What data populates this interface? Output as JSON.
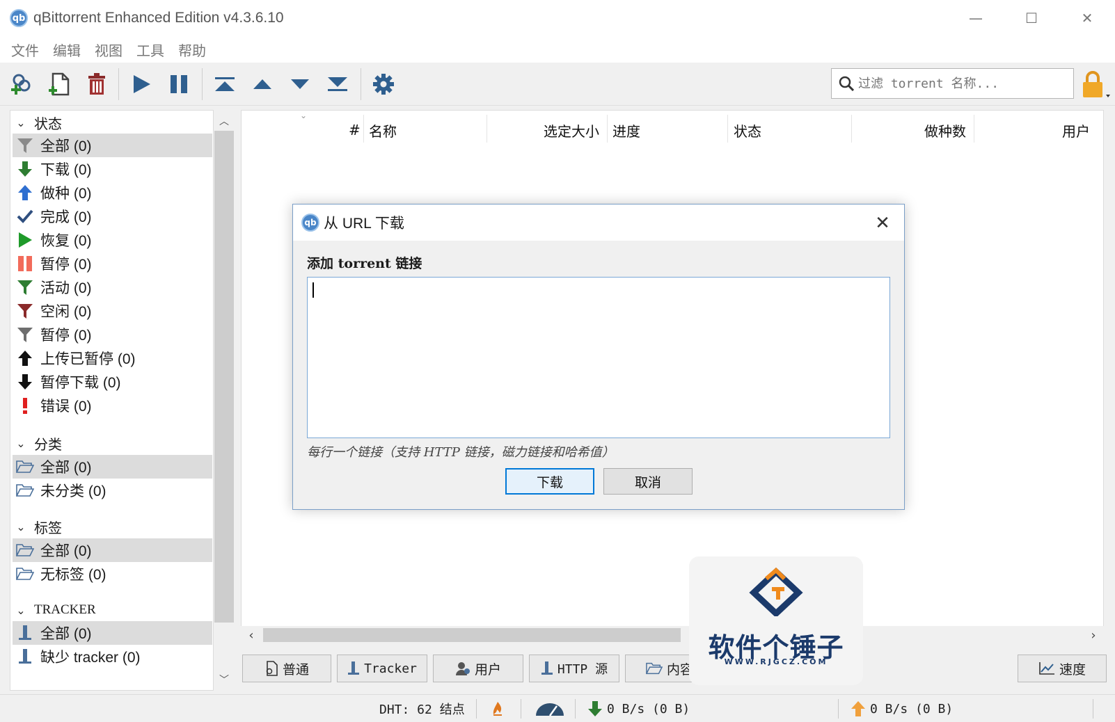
{
  "window": {
    "title": "qBittorrent Enhanced Edition v4.3.6.10",
    "logo_text": "qb",
    "minimize": "—",
    "maximize": "☐",
    "close": "✕"
  },
  "menu": [
    "文件",
    "编辑",
    "视图",
    "工具",
    "帮助"
  ],
  "toolbar": {
    "search_placeholder": "过滤 torrent 名称..."
  },
  "sidebar": {
    "sections": [
      {
        "label": "状态"
      },
      {
        "label": "分类"
      },
      {
        "label": "标签"
      },
      {
        "label": "TRACKER"
      }
    ],
    "status_items": [
      {
        "label": "全部 (0)",
        "icon": "filter-gray-icon"
      },
      {
        "label": "下载 (0)",
        "icon": "download-arrow-icon"
      },
      {
        "label": "做种 (0)",
        "icon": "upload-arrow-icon"
      },
      {
        "label": "完成 (0)",
        "icon": "checkmark-icon"
      },
      {
        "label": "恢复 (0)",
        "icon": "play-icon"
      },
      {
        "label": "暂停 (0)",
        "icon": "pause-icon"
      },
      {
        "label": "活动 (0)",
        "icon": "filter-green-icon"
      },
      {
        "label": "空闲 (0)",
        "icon": "filter-red-icon"
      },
      {
        "label": "暂停 (0)",
        "icon": "filter-gray-icon"
      },
      {
        "label": "上传已暂停 (0)",
        "icon": "upload-paused-icon"
      },
      {
        "label": "暂停下载 (0)",
        "icon": "download-paused-icon"
      },
      {
        "label": "错误 (0)",
        "icon": "error-icon"
      }
    ],
    "category_items": [
      {
        "label": "全部 (0)"
      },
      {
        "label": "未分类 (0)"
      }
    ],
    "tag_items": [
      {
        "label": "全部 (0)"
      },
      {
        "label": "无标签 (0)"
      }
    ],
    "tracker_items": [
      {
        "label": "全部 (0)"
      },
      {
        "label": "缺少 tracker (0)"
      }
    ]
  },
  "columns": [
    "#",
    "名称",
    "选定大小",
    "进度",
    "状态",
    "做种数",
    "用户"
  ],
  "bottom_tabs": [
    {
      "label": "普通",
      "icon": "general-doc-icon"
    },
    {
      "label": "Tracker",
      "icon": "tracker-icon"
    },
    {
      "label": "用户",
      "icon": "peers-icon"
    },
    {
      "label": "HTTP 源",
      "icon": "http-source-icon"
    },
    {
      "label": "内容",
      "icon": "folder-icon"
    },
    {
      "label": "速度",
      "icon": "speed-chart-icon"
    }
  ],
  "statusbar": {
    "dht": "DHT: 62 结点",
    "download": "0 B/s (0 B)",
    "upload": "0 B/s (0 B)"
  },
  "dialog": {
    "title": "从 URL 下载",
    "label": "添加 torrent 链接",
    "textarea_value": "",
    "hint": "每行一个链接（支持 HTTP 链接，磁力链接和哈希值）",
    "ok_label": "下载",
    "cancel_label": "取消"
  },
  "watermark": {
    "text": "软件个锤子",
    "sub": "WWW.RJGCZ.COM"
  },
  "colors": {
    "accent": "#0078d7",
    "selected_row": "#dcdcdc",
    "watermark": "#1b3a6b"
  }
}
